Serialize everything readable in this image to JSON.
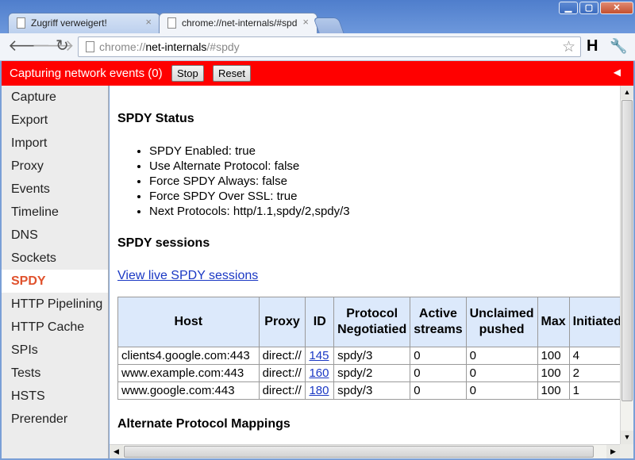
{
  "browser": {
    "tabs": [
      {
        "title": "Zugriff verweigert!",
        "active": false
      },
      {
        "title": "chrome://net-internals/#spdy",
        "active": true
      }
    ],
    "tab_close_glyph": "×",
    "new_tab_icon": "new-tab-icon",
    "window_controls": {
      "minimize": "▁",
      "maximize": "▢",
      "close": "✕"
    },
    "nav": {
      "back": "🡐",
      "forward": "🡒",
      "reload": "↻"
    },
    "url": {
      "scheme": "chrome://",
      "host": "net-internals",
      "path": "/#spdy"
    },
    "star_icon": "☆",
    "extension_label": "H",
    "wrench_icon": "🔧"
  },
  "capture_bar": {
    "status": "Capturing network events (0)",
    "stop_label": "Stop",
    "reset_label": "Reset",
    "collapse_icon": "◀",
    "color": "#ff0000"
  },
  "sidebar": {
    "items": [
      "Capture",
      "Export",
      "Import",
      "Proxy",
      "Events",
      "Timeline",
      "DNS",
      "Sockets",
      "SPDY",
      "HTTP Pipelining",
      "HTTP Cache",
      "SPIs",
      "Tests",
      "HSTS",
      "Prerender"
    ],
    "selected": "SPDY",
    "selected_color": "#e0522d"
  },
  "spdy": {
    "status_heading": "SPDY Status",
    "status_items": [
      "SPDY Enabled: true",
      "Use Alternate Protocol: false",
      "Force SPDY Always: false",
      "Force SPDY Over SSL: true",
      "Next Protocols: http/1.1,spdy/2,spdy/3"
    ],
    "sessions_heading": "SPDY sessions",
    "live_link": "View live SPDY sessions",
    "table": {
      "headers": [
        "Host",
        "Proxy",
        "ID",
        "Protocol Negotiatied",
        "Active streams",
        "Unclaimed pushed",
        "Max",
        "Initiated"
      ],
      "rows": [
        [
          "clients4.google.com:443",
          "direct://",
          "145",
          "spdy/3",
          "0",
          "0",
          "100",
          "4"
        ],
        [
          "www.example.com:443",
          "direct://",
          "160",
          "spdy/2",
          "0",
          "0",
          "100",
          "2"
        ],
        [
          "www.google.com:443",
          "direct://",
          "180",
          "spdy/3",
          "0",
          "0",
          "100",
          "1"
        ]
      ]
    },
    "alt_heading": "Alternate Protocol Mappings"
  },
  "scrollbars": {
    "up": "▲",
    "down": "▼",
    "left": "◀",
    "right": "▶"
  }
}
